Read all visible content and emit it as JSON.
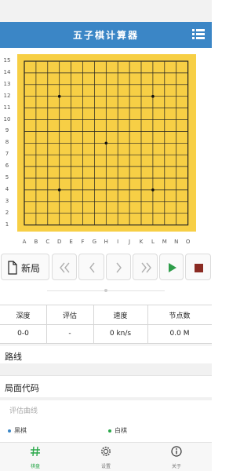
{
  "app": {
    "title": "五子棋计算器",
    "accent_color": "#3b86c6",
    "menu_icon": "list-menu-icon"
  },
  "board": {
    "size": 15,
    "color": "#f7cf45",
    "row_labels": [
      "15",
      "14",
      "13",
      "12",
      "11",
      "10",
      "9",
      "8",
      "7",
      "6",
      "5",
      "4",
      "3",
      "2",
      "1"
    ],
    "col_labels": [
      "A",
      "B",
      "C",
      "D",
      "E",
      "F",
      "G",
      "H",
      "I",
      "J",
      "K",
      "L",
      "M",
      "N",
      "O"
    ],
    "star_points": [
      "D12",
      "L12",
      "H8",
      "D4",
      "L4"
    ]
  },
  "controls": {
    "new_game_label": "新局",
    "new_game_icon": "document-icon",
    "first_icon": "double-chevron-left-icon",
    "prev_icon": "chevron-left-icon",
    "next_icon": "chevron-right-icon",
    "last_icon": "double-chevron-right-icon",
    "play_icon": "play-icon",
    "play_color": "#2e9d4a",
    "stop_icon": "stop-icon",
    "stop_color": "#8a2a22"
  },
  "stats": {
    "headers": [
      "深度",
      "评估",
      "速度",
      "节点数"
    ],
    "values": [
      "0-0",
      "-",
      "0 kn/s",
      "0.0 M"
    ]
  },
  "sections": {
    "line_label": "路线",
    "code_label": "局面代码",
    "curve_title": "评估曲线"
  },
  "legend": {
    "black_label": "黑棋",
    "black_color": "#3b86c6",
    "white_label": "白棋",
    "white_color": "#2aa84a"
  },
  "bottom_nav": {
    "items": [
      {
        "label": "棋盘",
        "icon": "hash-icon",
        "active": true
      },
      {
        "label": "设置",
        "icon": "gear-icon",
        "active": false
      },
      {
        "label": "关于",
        "icon": "info-icon",
        "active": false
      }
    ]
  }
}
